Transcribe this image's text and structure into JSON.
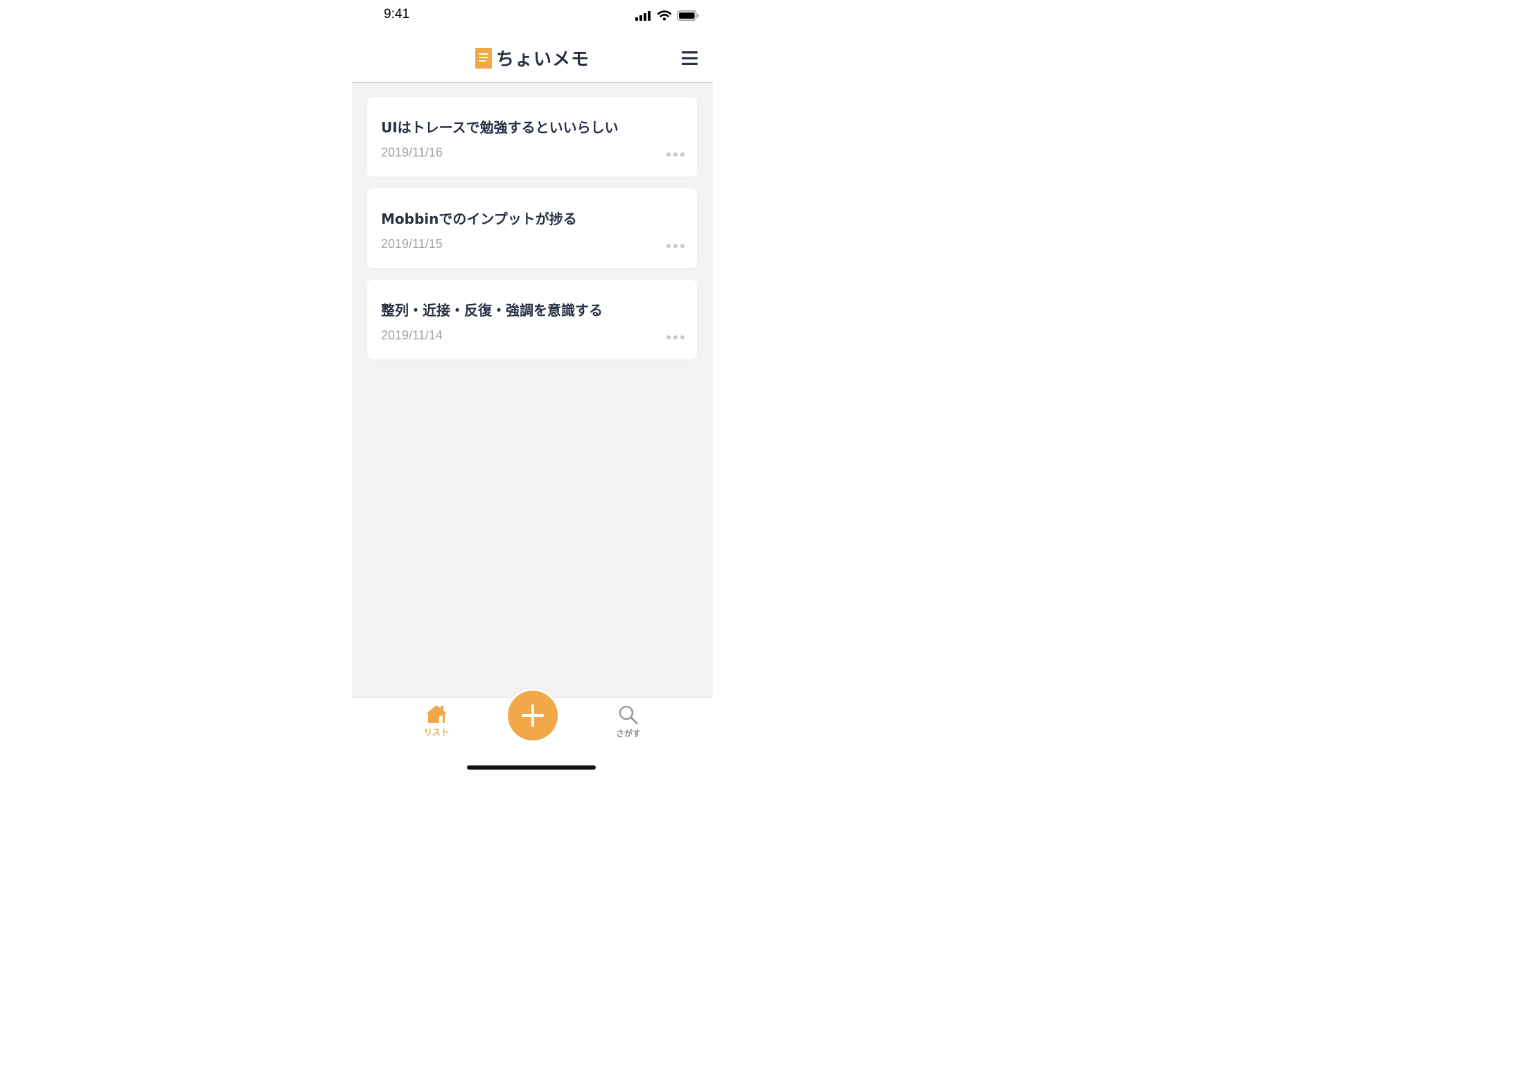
{
  "status_bar": {
    "time": "9:41"
  },
  "header": {
    "title": "ちょいメモ",
    "logo_icon": "note-icon",
    "menu_icon": "hamburger-menu-icon"
  },
  "memos": [
    {
      "title": "UIはトレースで勉強するといいらしい",
      "date": "2019/11/16"
    },
    {
      "title": "Mobbinでのインプットが捗る",
      "date": "2019/11/15"
    },
    {
      "title": "整列・近接・反復・強調を意識する",
      "date": "2019/11/14"
    }
  ],
  "tab_bar": {
    "list_label": "リスト",
    "search_label": "さがす",
    "add_icon": "plus-icon"
  },
  "colors": {
    "accent": "#f0a848",
    "text_primary": "#283044",
    "text_secondary": "#a3a3a3",
    "background": "#f2f2f2",
    "inactive": "#8e8e8e"
  }
}
